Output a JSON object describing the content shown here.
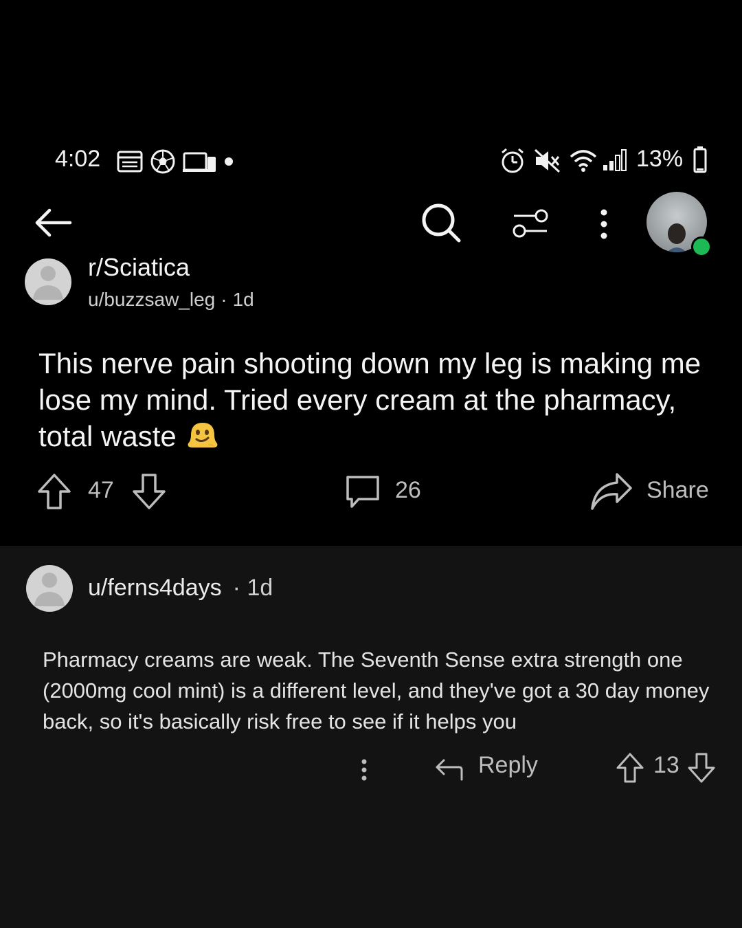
{
  "status_bar": {
    "time": "4:02",
    "battery_percent": "13%",
    "left_icons": [
      "calendar-icon",
      "soccer-ball-icon",
      "devices-icon",
      "notification-dot-icon"
    ],
    "right_icons": [
      "alarm-icon",
      "mute-icon",
      "wifi-icon",
      "signal-icon",
      "battery-icon"
    ]
  },
  "header": {
    "icons": [
      "back-arrow-icon",
      "search-icon",
      "filter-sliders-icon",
      "more-vertical-icon",
      "profile-avatar"
    ],
    "online_status_color": "#1db954"
  },
  "post": {
    "subreddit": "r/Sciatica",
    "author": "u/buzzsaw_leg",
    "separator": "·",
    "age": "1d",
    "title": "This nerve pain shooting down my leg is making me lose my mind. Tried every cream at the pharmacy, total waste",
    "title_emoji": "melting-face-emoji",
    "votes": "47",
    "comments": "26",
    "share_label": "Share"
  },
  "comment": {
    "author": "u/ferns4days",
    "age": "· 1d",
    "body": "Pharmacy creams are weak. The Seventh Sense extra strength one (2000mg cool mint) is a different level, and they've got a 30 day money back, so it's basically risk free to see if it helps you",
    "reply_label": "Reply",
    "votes": "13"
  },
  "colors": {
    "background": "#131313",
    "top_background": "#000000",
    "text": "#e6e6e6",
    "muted": "#bdbdbd"
  }
}
